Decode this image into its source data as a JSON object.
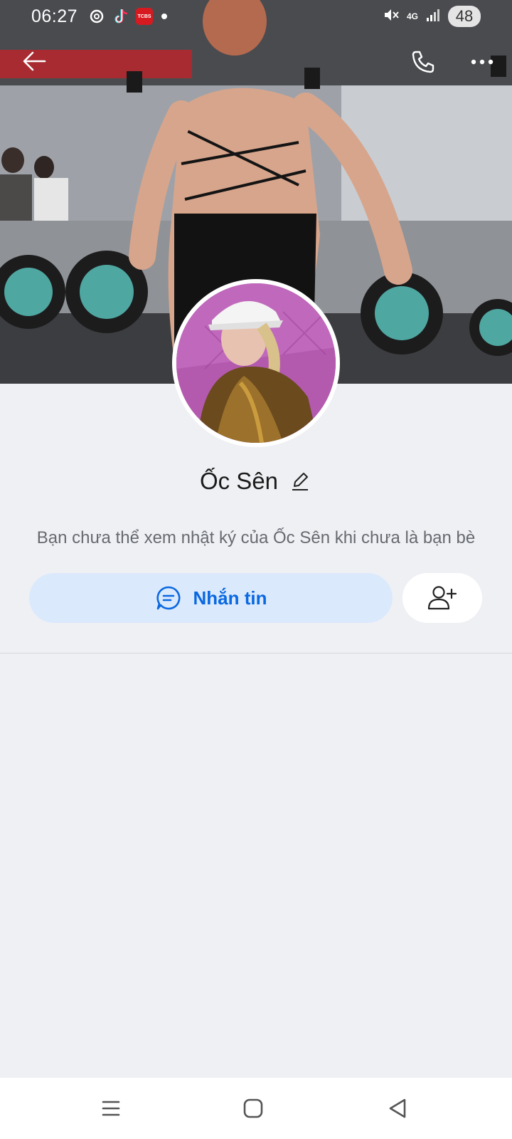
{
  "status_bar": {
    "time": "06:27",
    "apps": [
      "threads-icon",
      "tiktok-icon",
      "tcbs-icon"
    ],
    "tcbs_label": "TCBS",
    "network": "4G",
    "battery": "48"
  },
  "top_bar": {
    "back_icon": "arrow-left-icon",
    "call_icon": "phone-icon",
    "more_icon": "more-horizontal-icon"
  },
  "profile": {
    "name": "Ốc Sên",
    "notice": "Bạn chưa thể xem nhật ký của Ốc Sên khi chưa là bạn bè"
  },
  "actions": {
    "message_label": "Nhắn tin",
    "message_icon": "chat-bubble-icon",
    "add_friend_icon": "add-user-icon"
  },
  "colors": {
    "accent": "#0a68e0",
    "message_bg": "#dbe9fd",
    "page_bg": "#eff0f4"
  },
  "nav_bar": {
    "menu_icon": "recents-icon",
    "home_icon": "home-icon",
    "back_icon": "back-triangle-icon"
  }
}
